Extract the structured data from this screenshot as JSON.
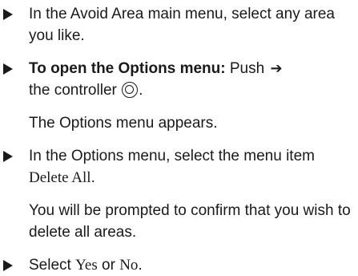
{
  "steps": [
    {
      "text": "In the Avoid Area main menu, select any area you like."
    },
    {
      "bold_lead": "To open the Options menu:",
      "text_pre": " Push ",
      "arrow_icon": "right-arrow",
      "text_post": "the controller ",
      "controller_icon": "controller-press",
      "text_end": ".",
      "result": "The Options menu appears."
    },
    {
      "text_pre": "In the Options menu, select the menu item ",
      "menu_item": "Delete All",
      "text_end": ".",
      "result": "You will be prompted to confirm that you wish to delete all areas."
    },
    {
      "text_pre": "Select ",
      "option_yes": "Yes",
      "text_mid": " or ",
      "option_no": "No",
      "text_end": "."
    }
  ]
}
